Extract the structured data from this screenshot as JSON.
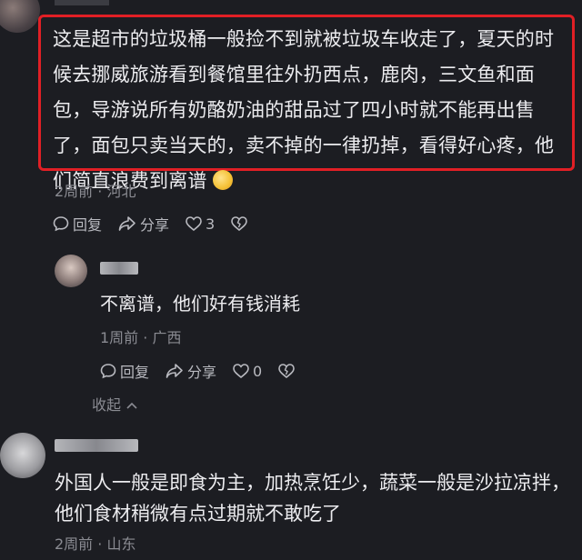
{
  "comments": [
    {
      "text": "这是超市的垃圾桶一般捡不到就被垃圾车收走了，夏天的时候去挪威旅游看到餐馆里往外扔西点，鹿肉，三文鱼和面包，导游说所有奶酪奶油的甜品过了四小时就不能再出售了，面包只卖当天的，卖不掉的一律扔掉，看得好心疼，他们简直浪费到离谱",
      "time": "2周前",
      "location": "河北",
      "reply_label": "回复",
      "share_label": "分享",
      "likes": "3"
    },
    {
      "text": "外国人一般是即食为主，加热烹饪少，蔬菜一般是沙拉凉拌，他们食材稍微有点过期就不敢吃了",
      "time": "2周前",
      "location": "山东"
    }
  ],
  "reply": {
    "text": "不离谱，他们好有钱消耗",
    "time": "1周前",
    "location": "广西",
    "reply_label": "回复",
    "share_label": "分享",
    "likes": "0"
  },
  "collapse_label": "收起",
  "colors": {
    "highlight": "#e11f25",
    "background": "#1c1d22"
  }
}
